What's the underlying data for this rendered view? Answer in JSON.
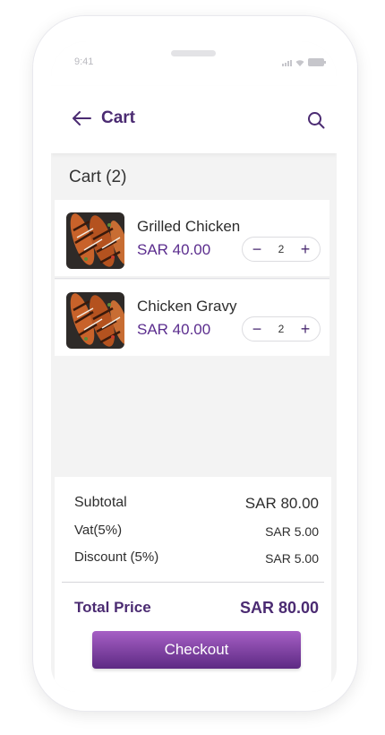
{
  "status_bar": {
    "time": "9:41"
  },
  "header": {
    "title": "Cart"
  },
  "cart": {
    "count_label": "Cart (2)",
    "items": [
      {
        "name": "Grilled Chicken",
        "price": "SAR 40.00",
        "quantity": "2"
      },
      {
        "name": "Chicken Gravy",
        "price": "SAR 40.00",
        "quantity": "2"
      }
    ]
  },
  "summary": {
    "subtotal_label": "Subtotal",
    "subtotal_value": "SAR 80.00",
    "vat_label": "Vat(5%)",
    "vat_value": "SAR 5.00",
    "discount_label": "Discount (5%)",
    "discount_value": "SAR 5.00",
    "total_label": "Total Price",
    "total_value": "SAR 80.00"
  },
  "checkout_label": "Checkout",
  "icons": {
    "minus": "minus-icon",
    "plus": "plus-icon",
    "back": "arrow-left-icon",
    "search": "search-icon"
  },
  "colors": {
    "brand": "#4b2b72",
    "price": "#5b2d8e",
    "checkout_gradient": [
      "#a65fc5",
      "#5d2a83"
    ]
  }
}
